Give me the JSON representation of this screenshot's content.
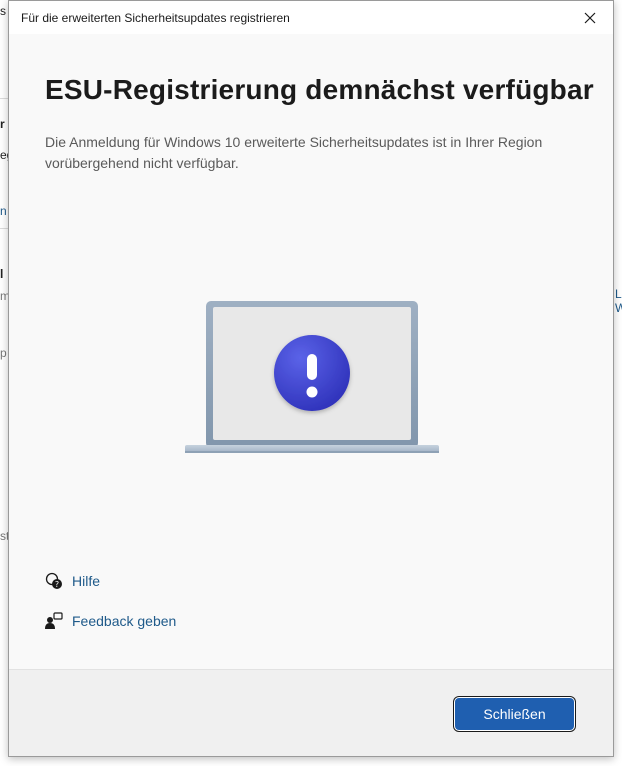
{
  "background_window": {
    "fragments": [
      "s",
      "r",
      "eg",
      "n",
      "l",
      "m",
      "p",
      "st",
      "L W"
    ]
  },
  "dialog": {
    "title": "Für die erweiterten Sicherheitsupdates registrieren",
    "close_icon": "close-icon",
    "heading": "ESU-Registrierung demnächst verfügbar",
    "description": "Die Anmeldung für Windows 10 erweiterte Sicherheitsupdates ist in Ihrer Region vorübergehend nicht verfügbar.",
    "illustration_icon": "laptop-exclamation-icon",
    "links": [
      {
        "label": "Hilfe",
        "icon": "help-icon"
      },
      {
        "label": "Feedback geben",
        "icon": "feedback-icon"
      }
    ],
    "close_button_label": "Schließen"
  },
  "colors": {
    "accent": "#1f5fb0",
    "link": "#1f5a8a",
    "badge_gradient_start": "#5b63e8",
    "badge_gradient_end": "#2c2fb8"
  }
}
